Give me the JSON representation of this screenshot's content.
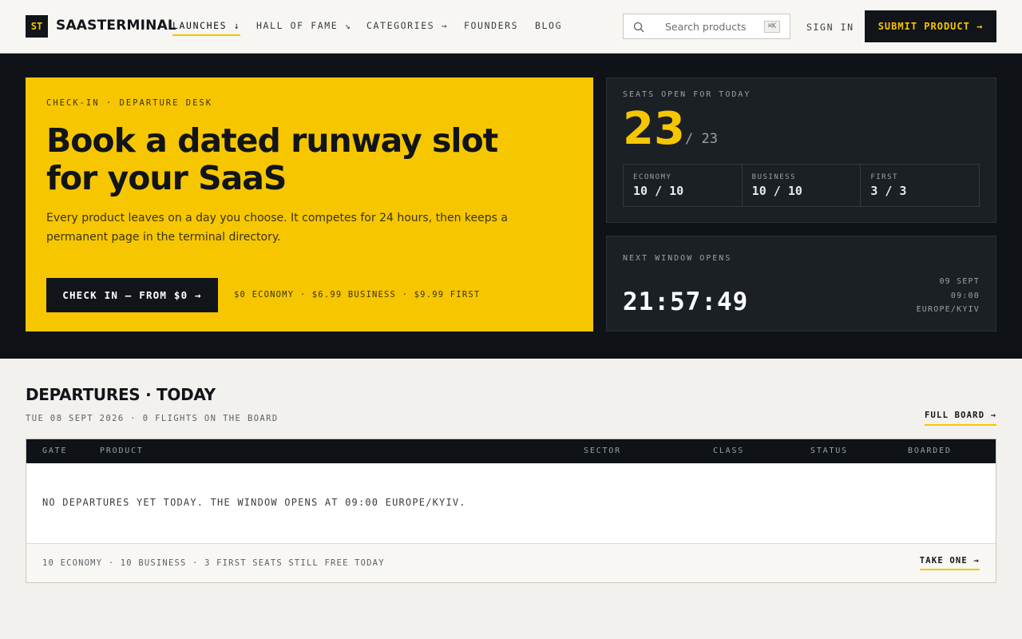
{
  "brand": {
    "logo_mark": "ST",
    "name": "SAASTERMINAL"
  },
  "nav": [
    {
      "label": "LAUNCHES ↓",
      "active": true
    },
    {
      "label": "HALL OF FAME ↘"
    },
    {
      "label": "CATEGORIES →"
    },
    {
      "label": "FOUNDERS"
    },
    {
      "label": "BLOG"
    }
  ],
  "search": {
    "placeholder": "Search products",
    "shortcut": "⌘K",
    "icon": "search-icon"
  },
  "header_actions": {
    "sign_in": "SIGN IN",
    "submit": "SUBMIT PRODUCT →"
  },
  "hero": {
    "eyebrow": "CHECK-IN · DEPARTURE DESK",
    "headline": "Book a dated runway slot for your SaaS",
    "lede": "Every product leaves on a day you choose. It competes for 24 hours, then keeps a permanent page in the terminal directory.",
    "cta": "CHECK IN — FROM $0 →",
    "prices": "$0 ECONOMY · $6.99 BUSINESS · $9.99 FIRST"
  },
  "seats": {
    "label": "SEATS OPEN FOR TODAY",
    "open": "23",
    "total": "/ 23",
    "classes": [
      {
        "name": "ECONOMY",
        "value": "10 / 10"
      },
      {
        "name": "BUSINESS",
        "value": "10 / 10"
      },
      {
        "name": "FIRST",
        "value": "3 / 3"
      }
    ]
  },
  "window": {
    "label": "NEXT WINDOW OPENS",
    "countdown": "21:57:49",
    "date": "09 SEPT",
    "time": "09:00",
    "timezone": "EUROPE/KYIV"
  },
  "departures": {
    "title": "DEPARTURES · TODAY",
    "subtitle": "TUE 08 SEPT 2026 · 0 FLIGHTS ON THE BOARD",
    "full_board": "FULL BOARD →",
    "columns": [
      "GATE",
      "PRODUCT",
      "SECTOR",
      "CLASS",
      "STATUS",
      "BOARDED"
    ],
    "empty_message": "NO DEPARTURES YET TODAY. THE WINDOW OPENS AT 09:00 EUROPE/KYIV.",
    "footer_text": "10 ECONOMY · 10 BUSINESS · 3 FIRST SEATS STILL FREE TODAY",
    "footer_action": "TAKE ONE →"
  },
  "colors": {
    "accent": "#f6c600",
    "dark": "#0f1317",
    "panel": "#1b2025",
    "background": "#f2f1ed"
  }
}
